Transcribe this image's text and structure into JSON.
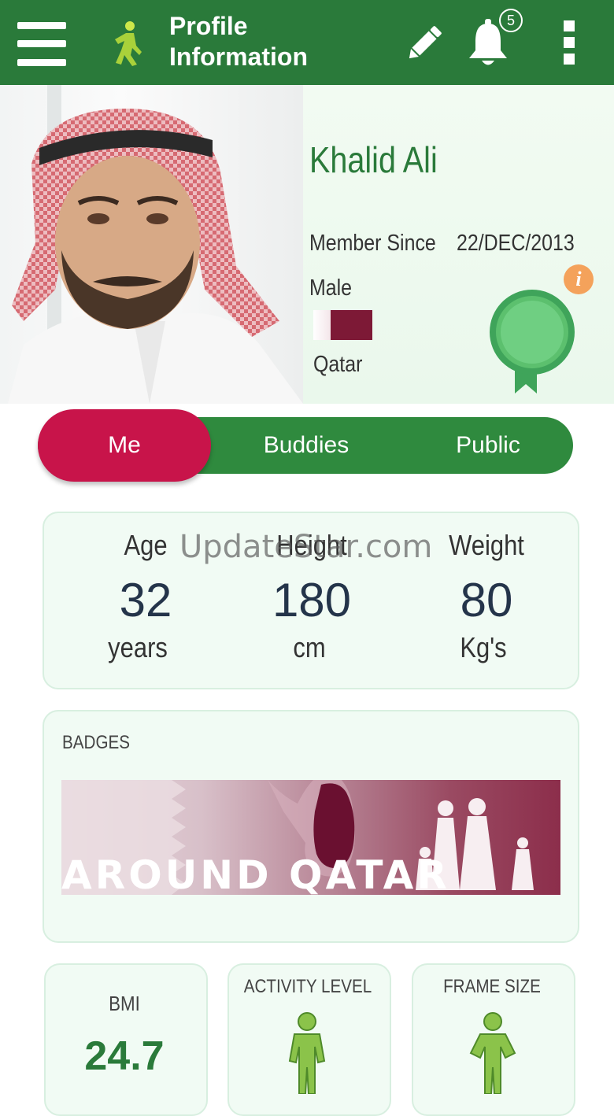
{
  "header": {
    "title_line1": "Profile",
    "title_line2": "Information",
    "notification_count": "5",
    "bar_color": "#2a7a3a"
  },
  "profile": {
    "name": "Khalid Ali",
    "member_since_label": "Member Since",
    "member_since_date": "22/DEC/2013",
    "gender": "Male",
    "country": "Qatar",
    "info_icon_text": "i",
    "name_color": "#2a7a3a"
  },
  "tabs": {
    "me": "Me",
    "buddies": "Buddies",
    "public": "Public",
    "active_color": "#c8144a",
    "inactive_color": "#2f8a3e"
  },
  "stats": {
    "age": {
      "label": "Age",
      "value": "32",
      "unit": "years"
    },
    "height": {
      "label": "Height",
      "value": "180",
      "unit": "cm"
    },
    "weight": {
      "label": "Weight",
      "value": "80",
      "unit": "Kg's"
    }
  },
  "watermark": "UpdateStar.com",
  "badges": {
    "heading": "BADGES",
    "banner_text": "AROUND QATAR"
  },
  "bmi": {
    "label": "BMI",
    "value": "24.7"
  },
  "activity": {
    "label": "ACTIVITY LEVEL"
  },
  "frame": {
    "label": "FRAME SIZE"
  },
  "icons": [
    "menu-icon",
    "walker-icon",
    "pencil-icon",
    "bell-icon",
    "more-vert-icon",
    "info-icon",
    "rosette-icon",
    "figure-icon"
  ]
}
